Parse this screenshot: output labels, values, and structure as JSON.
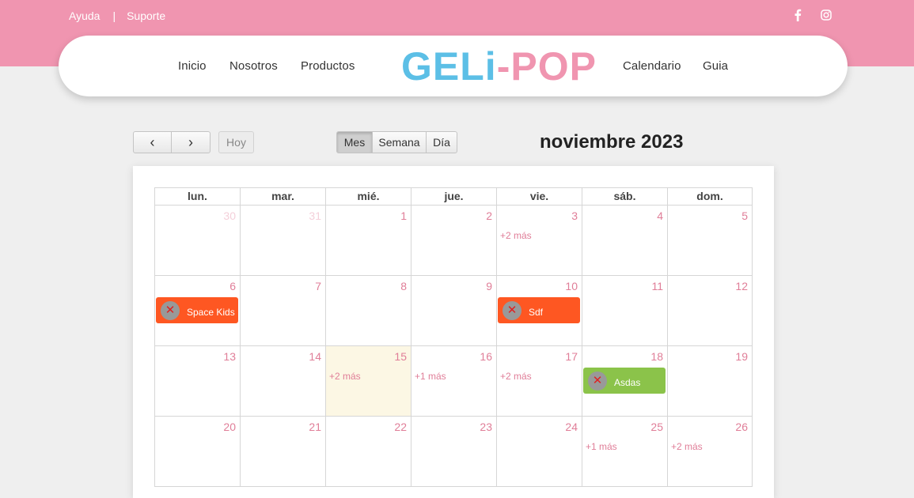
{
  "header": {
    "help": "Ayuda",
    "separator": "|",
    "support": "Suporte",
    "social": [
      "facebook-icon",
      "instagram-icon"
    ],
    "colors": {
      "topbar": "#f095b0",
      "logo_primary": "#5cbfe6",
      "logo_secondary": "#f095b0"
    }
  },
  "nav": {
    "left": [
      "Inicio",
      "Nosotros",
      "Productos"
    ],
    "logo_part1": "GELi",
    "logo_dash": "-",
    "logo_part2": "POP",
    "right": [
      "Calendario",
      "Guia"
    ]
  },
  "toolbar": {
    "prev": "‹",
    "next": "›",
    "today": "Hoy",
    "views": [
      "Mes",
      "Semana",
      "Día"
    ],
    "active_view": "Mes",
    "title": "noviembre 2023"
  },
  "calendar": {
    "weekdays": [
      "lun.",
      "mar.",
      "mié.",
      "jue.",
      "vie.",
      "sáb.",
      "dom."
    ],
    "weeks": [
      [
        {
          "n": "30",
          "other": true
        },
        {
          "n": "31",
          "other": true
        },
        {
          "n": "1"
        },
        {
          "n": "2"
        },
        {
          "n": "3",
          "more": "+2 más"
        },
        {
          "n": "4"
        },
        {
          "n": "5"
        }
      ],
      [
        {
          "n": "6",
          "event": {
            "label": "Space Kids",
            "color": "#fe5722"
          }
        },
        {
          "n": "7"
        },
        {
          "n": "8"
        },
        {
          "n": "9"
        },
        {
          "n": "10",
          "event": {
            "label": "Sdf",
            "color": "#fe5722"
          }
        },
        {
          "n": "11"
        },
        {
          "n": "12"
        }
      ],
      [
        {
          "n": "13"
        },
        {
          "n": "14"
        },
        {
          "n": "15",
          "today": true,
          "more": "+2 más"
        },
        {
          "n": "16",
          "more": "+1 más"
        },
        {
          "n": "17",
          "more": "+2 más"
        },
        {
          "n": "18",
          "event": {
            "label": "Asdas",
            "color": "#8bc34a"
          }
        },
        {
          "n": "19"
        }
      ],
      [
        {
          "n": "20"
        },
        {
          "n": "21"
        },
        {
          "n": "22"
        },
        {
          "n": "23"
        },
        {
          "n": "24"
        },
        {
          "n": "25",
          "more": "+1 más"
        },
        {
          "n": "26",
          "more": "+2 más"
        }
      ]
    ],
    "remove_symbol": "✕"
  }
}
